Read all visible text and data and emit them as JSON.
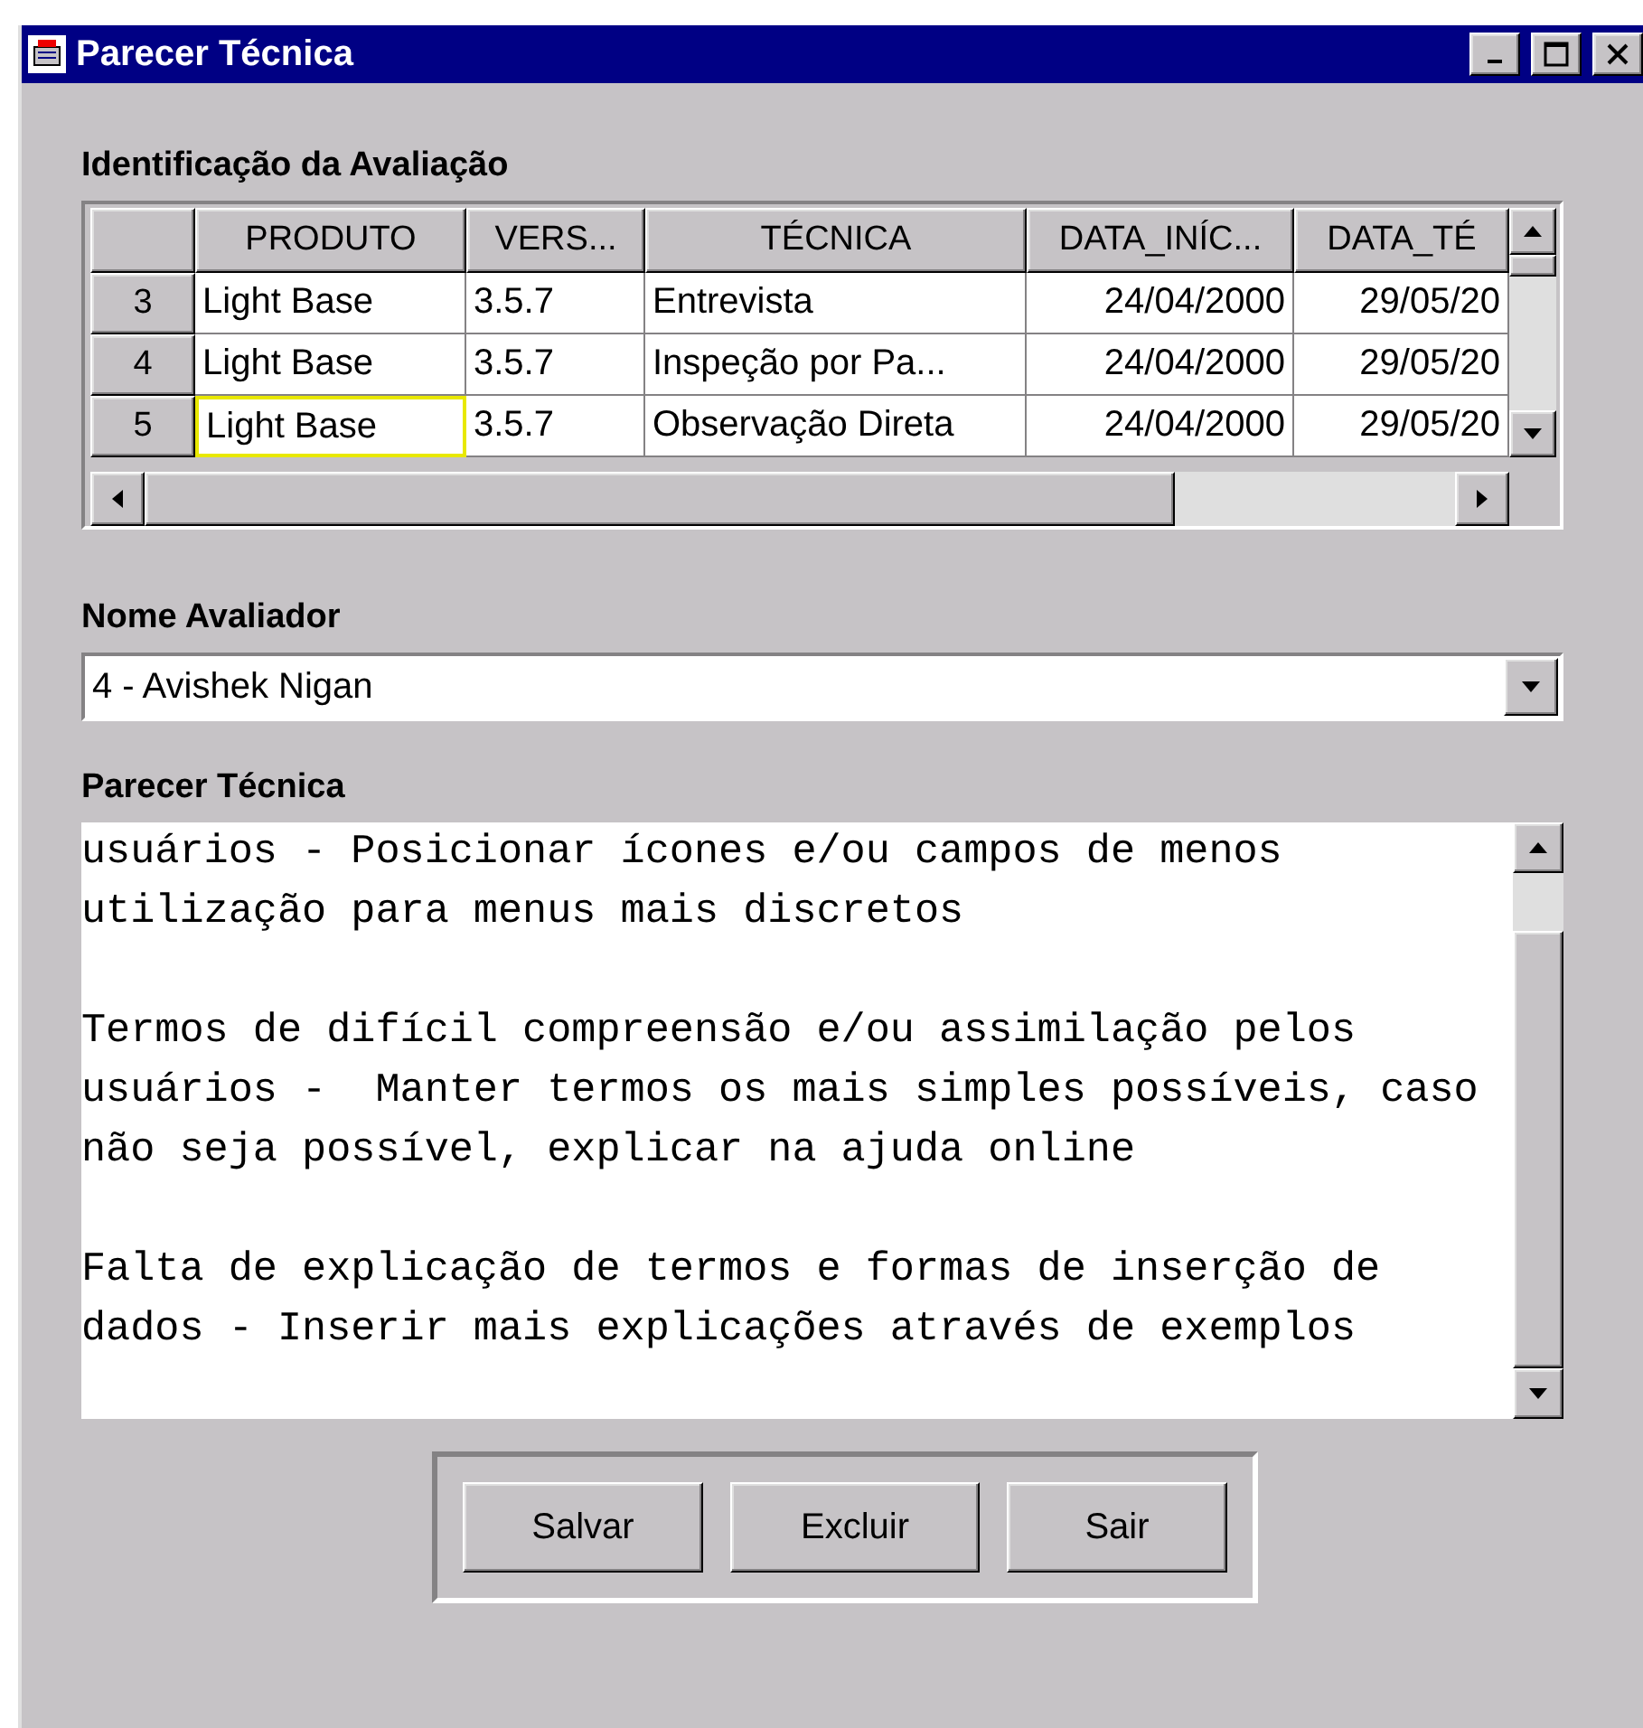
{
  "window": {
    "title": "Parecer Técnica"
  },
  "evaluation": {
    "label": "Identificação da Avaliação",
    "columns": [
      {
        "label": "PRODUTO",
        "kind": "text"
      },
      {
        "label": "VERS...",
        "kind": "text"
      },
      {
        "label": "TÉCNICA",
        "kind": "text"
      },
      {
        "label": "DATA_INÍC...",
        "kind": "date"
      },
      {
        "label": "DATA_TÉ",
        "kind": "date"
      }
    ],
    "rows": [
      {
        "header": "3",
        "cells": [
          {
            "text": "Light Base",
            "focused": false
          },
          {
            "text": "3.5.7",
            "focused": false
          },
          {
            "text": "Entrevista",
            "focused": false
          },
          {
            "text": "24/04/2000",
            "focused": false
          },
          {
            "text": "29/05/20",
            "focused": false
          }
        ]
      },
      {
        "header": "4",
        "cells": [
          {
            "text": "Light Base",
            "focused": false
          },
          {
            "text": "3.5.7",
            "focused": false
          },
          {
            "text": "Inspeção por Pa...",
            "focused": false
          },
          {
            "text": "24/04/2000",
            "focused": false
          },
          {
            "text": "29/05/20",
            "focused": false
          }
        ]
      },
      {
        "header": "5",
        "cells": [
          {
            "text": "Light Base",
            "focused": true
          },
          {
            "text": "3.5.7",
            "focused": false
          },
          {
            "text": "Observação Direta",
            "focused": false
          },
          {
            "text": "24/04/2000",
            "focused": false
          },
          {
            "text": "29/05/20",
            "focused": false
          }
        ]
      }
    ]
  },
  "evaluator": {
    "label": "Nome Avaliador",
    "value": "4 - Avishek Nigan"
  },
  "opinion": {
    "label": "Parecer Técnica",
    "value": "usuários - Posicionar ícones e/ou campos de menos\nutilização para menus mais discretos\n\nTermos de difícil compreensão e/ou assimilação pelos\nusuários -  Manter termos os mais simples possíveis, caso\nnão seja possível, explicar na ajuda online\n\nFalta de explicação de termos e formas de inserção de\ndados - Inserir mais explicações através de exemplos"
  },
  "buttons": [
    "Salvar",
    "Excluir",
    "Sair"
  ]
}
